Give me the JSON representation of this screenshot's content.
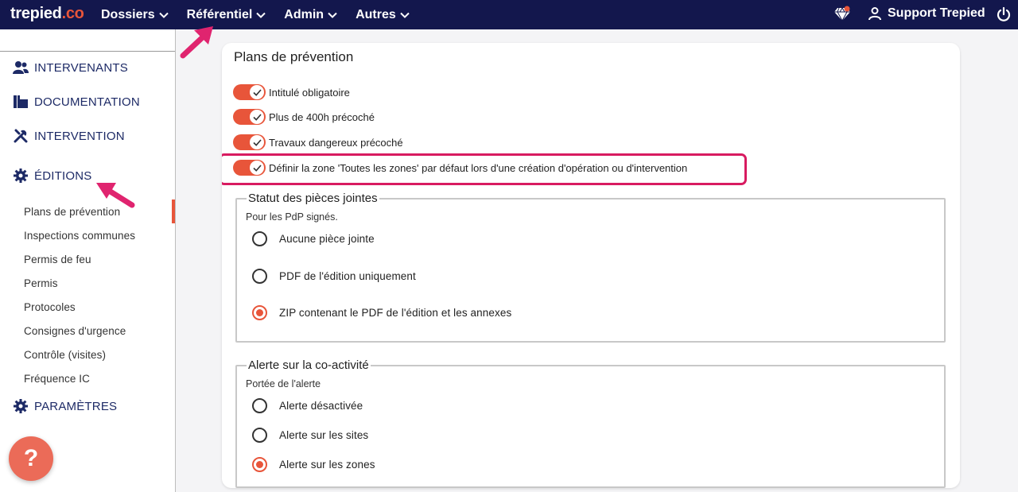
{
  "topbar": {
    "logo_main": "trepied",
    "logo_suffix": ".co",
    "nav": [
      "Dossiers",
      "Référentiel",
      "Admin",
      "Autres"
    ],
    "user_label": "Support Trepied"
  },
  "sidebar": {
    "sections": {
      "intervenants": "INTERVENANTS",
      "documentation": "DOCUMENTATION",
      "intervention": "INTERVENTION",
      "editions": "ÉDITIONS",
      "parametres": "PARAMÈTRES"
    },
    "sub_items": [
      "Plans de prévention",
      "Inspections communes",
      "Permis de feu",
      "Permis",
      "Protocoles",
      "Consignes d'urgence",
      "Contrôle (visites)",
      "Fréquence IC"
    ],
    "active_item": "Plans de prévention",
    "help": "?"
  },
  "main": {
    "title": "Plans de prévention",
    "toggles": [
      {
        "label": "Intitulé obligatoire",
        "on": true
      },
      {
        "label": "Plus de 400h précoché",
        "on": true
      },
      {
        "label": "Travaux dangereux précoché",
        "on": true
      },
      {
        "label": "Définir la zone 'Toutes les zones' par défaut lors d'une création d'opération ou d'intervention",
        "on": true
      }
    ],
    "attachments": {
      "legend": "Statut des pièces jointes",
      "hint": "Pour les PdP signés.",
      "options": [
        "Aucune pièce jointe",
        "PDF de l'édition uniquement",
        "ZIP contenant le PDF de l'édition et les annexes"
      ],
      "selected": "ZIP contenant le PDF de l'édition et les annexes"
    },
    "coactivity": {
      "legend": "Alerte sur la co-activité",
      "hint": "Portée de l'alerte",
      "options": [
        "Alerte désactivée",
        "Alerte sur les sites",
        "Alerte sur les zones"
      ],
      "selected": "Alerte sur les zones"
    }
  },
  "colors": {
    "topbar": "#13174d",
    "accent": "#e8553a",
    "annotation": "#d81b60",
    "sidebar_text": "#1d2a66"
  }
}
